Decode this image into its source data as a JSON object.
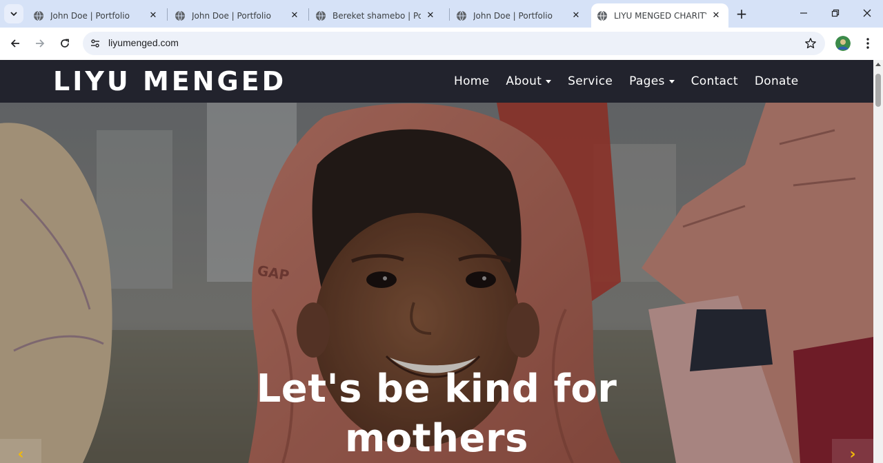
{
  "browser": {
    "tabs": [
      {
        "title": "John Doe | Portfolio",
        "active": false
      },
      {
        "title": "John Doe | Portfolio",
        "active": false
      },
      {
        "title": "Bereket shamebo | Portfolio",
        "active": false
      },
      {
        "title": "John Doe | Portfolio",
        "active": false
      },
      {
        "title": "LIYU MENGED CHARITY ASSOCIATION",
        "active": true
      }
    ],
    "url": "liyumenged.com",
    "icons": {
      "tab_search": "chevron-down-icon",
      "favicon": "globe-icon",
      "close": "close-icon",
      "new_tab": "plus-icon",
      "back": "back-arrow-icon",
      "forward": "forward-arrow-icon",
      "reload": "reload-icon",
      "site_info": "tune-icon",
      "bookmark": "star-icon",
      "menu": "more-vert-icon"
    }
  },
  "site": {
    "brand": "LIYU MENGED",
    "nav": [
      {
        "label": "Home",
        "dropdown": false
      },
      {
        "label": "About",
        "dropdown": true
      },
      {
        "label": "Service",
        "dropdown": false
      },
      {
        "label": "Pages",
        "dropdown": true
      },
      {
        "label": "Contact",
        "dropdown": false
      },
      {
        "label": "Donate",
        "dropdown": false
      }
    ],
    "hero": {
      "line1": "Let's be kind for",
      "line2": "mothers",
      "prev_icon": "chevron-left-icon",
      "next_icon": "chevron-right-icon"
    },
    "colors": {
      "navbar_bg": "#22232d",
      "accent": "#f0b90b"
    }
  }
}
